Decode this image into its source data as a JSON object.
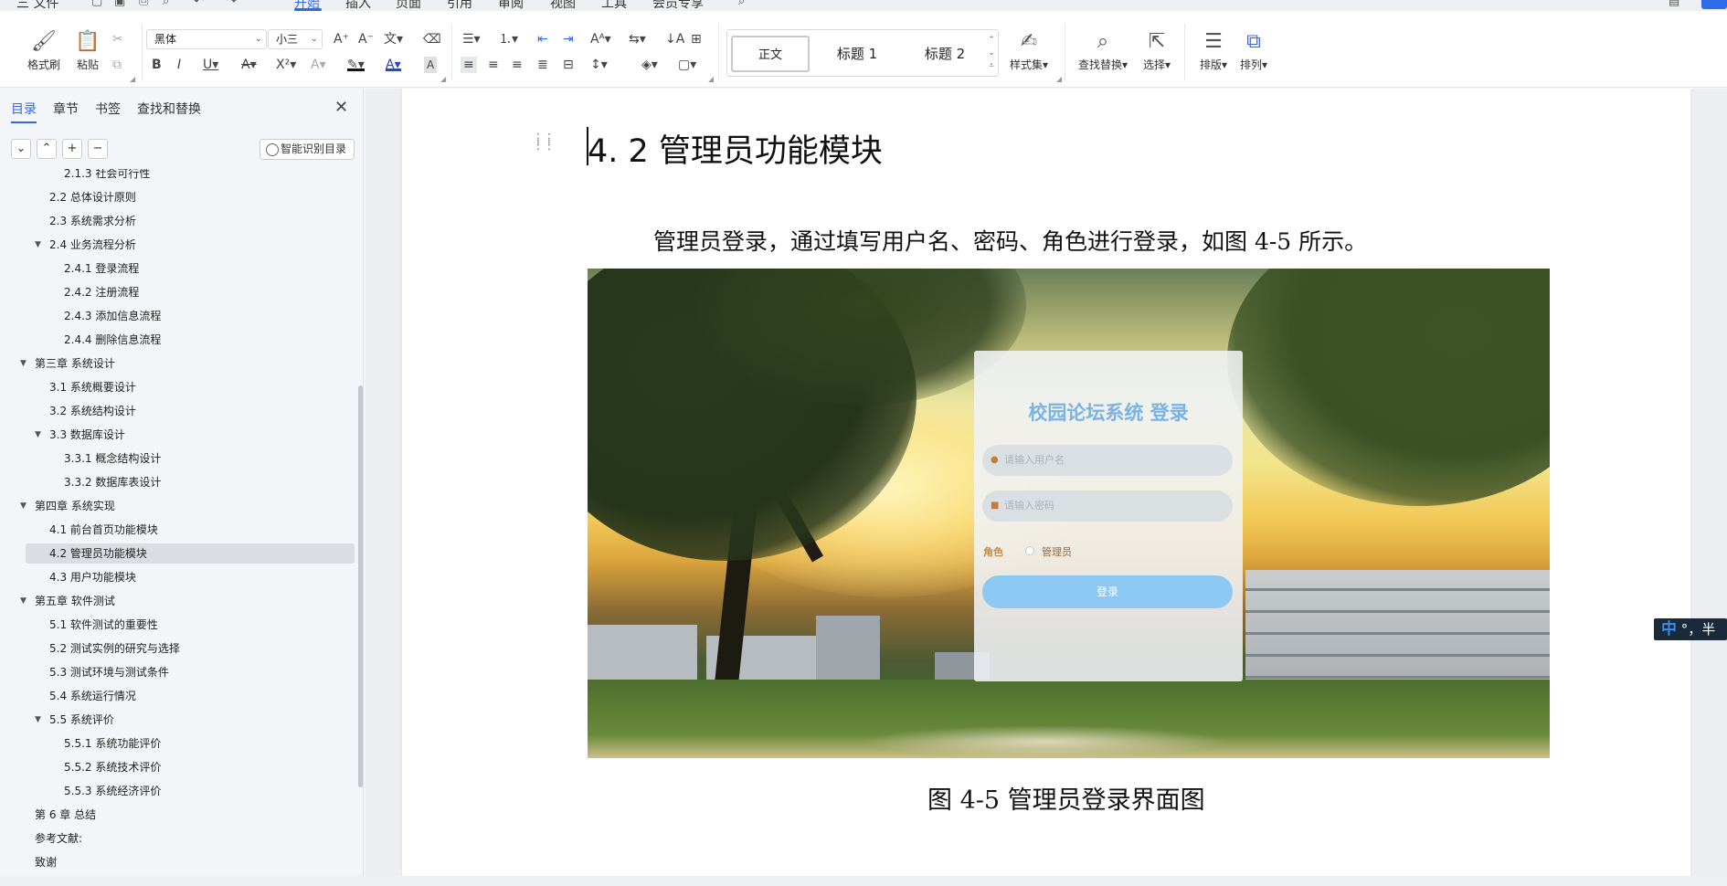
{
  "menubar": {
    "file": "三 文件",
    "tabs": [
      "开始",
      "插入",
      "页面",
      "引用",
      "审阅",
      "视图",
      "工具",
      "会员专享"
    ],
    "active_tab": "开始"
  },
  "ribbon": {
    "format_painter": "格式刷",
    "paste": "粘贴",
    "font_name": "黑体",
    "font_size": "小三",
    "styles": [
      "正文",
      "标题 1",
      "标题 2"
    ],
    "style_set": "样式集",
    "find_replace": "查找替换",
    "select": "选择",
    "layout": "排版",
    "arrange": "排列"
  },
  "sidebar": {
    "tabs": [
      "目录",
      "章节",
      "书签",
      "查找和替换"
    ],
    "active_tab": "目录",
    "smart_toc": "智能识别目录",
    "toc": [
      {
        "label": "2.1.3 社会可行性",
        "level": 3,
        "arrow": ""
      },
      {
        "label": "2.2 总体设计原则",
        "level": 2,
        "arrow": ""
      },
      {
        "label": "2.3  系统需求分析",
        "level": 2,
        "arrow": ""
      },
      {
        "label": "2.4  业务流程分析",
        "level": 2,
        "arrow": "▼"
      },
      {
        "label": "2.4.1 登录流程",
        "level": 3,
        "arrow": ""
      },
      {
        "label": "2.4.2 注册流程",
        "level": 3,
        "arrow": ""
      },
      {
        "label": "2.4.3 添加信息流程",
        "level": 3,
        "arrow": ""
      },
      {
        "label": "2.4.4 删除信息流程",
        "level": 3,
        "arrow": ""
      },
      {
        "label": "第三章  系统设计",
        "level": 1,
        "arrow": "▼"
      },
      {
        "label": "3.1  系统概要设计",
        "level": 2,
        "arrow": ""
      },
      {
        "label": "3.2 系统结构设计",
        "level": 2,
        "arrow": ""
      },
      {
        "label": "3.3  数据库设计",
        "level": 2,
        "arrow": "▼"
      },
      {
        "label": "3.3.1 概念结构设计",
        "level": 3,
        "arrow": ""
      },
      {
        "label": "3.3.2 数据库表设计",
        "level": 3,
        "arrow": ""
      },
      {
        "label": "第四章  系统实现",
        "level": 1,
        "arrow": "▼"
      },
      {
        "label": "4.1 前台首页功能模块",
        "level": 2,
        "arrow": ""
      },
      {
        "label": "4.2 管理员功能模块",
        "level": 2,
        "arrow": "",
        "selected": true
      },
      {
        "label": "4.3 用户功能模块",
        "level": 2,
        "arrow": ""
      },
      {
        "label": "第五章    软件测试",
        "level": 1,
        "arrow": "▼"
      },
      {
        "label": "5.1 软件测试的重要性",
        "level": 2,
        "arrow": ""
      },
      {
        "label": "5.2 测试实例的研究与选择",
        "level": 2,
        "arrow": ""
      },
      {
        "label": "5.3 测试环境与测试条件",
        "level": 2,
        "arrow": ""
      },
      {
        "label": "5.4 系统运行情况",
        "level": 2,
        "arrow": ""
      },
      {
        "label": "5.5 系统评价",
        "level": 2,
        "arrow": "▼"
      },
      {
        "label": "5.5.1 系统功能评价",
        "level": 3,
        "arrow": ""
      },
      {
        "label": "5.5.2 系统技术评价",
        "level": 3,
        "arrow": ""
      },
      {
        "label": "5.5.3 系统经济评价",
        "level": 3,
        "arrow": ""
      },
      {
        "label": "第 6 章  总结",
        "level": 1,
        "arrow": ""
      },
      {
        "label": "参考文献:",
        "level": 1,
        "arrow": ""
      },
      {
        "label": "致谢",
        "level": 1,
        "arrow": ""
      }
    ]
  },
  "document": {
    "heading": "4. 2 管理员功能模块",
    "paragraph": "管理员登录，通过填写用户名、密码、角色进行登录，如图 4-5 所示。",
    "caption": "图 4-5 管理员登录界面图",
    "figure": {
      "title": "校园论坛系统 登录",
      "username_placeholder": "请输入用户名",
      "password_placeholder": "请输入密码",
      "role_label": "角色",
      "role_option": "管理员",
      "login_button": "登录"
    }
  },
  "ime": {
    "mode": "中",
    "rest": "°，半"
  }
}
